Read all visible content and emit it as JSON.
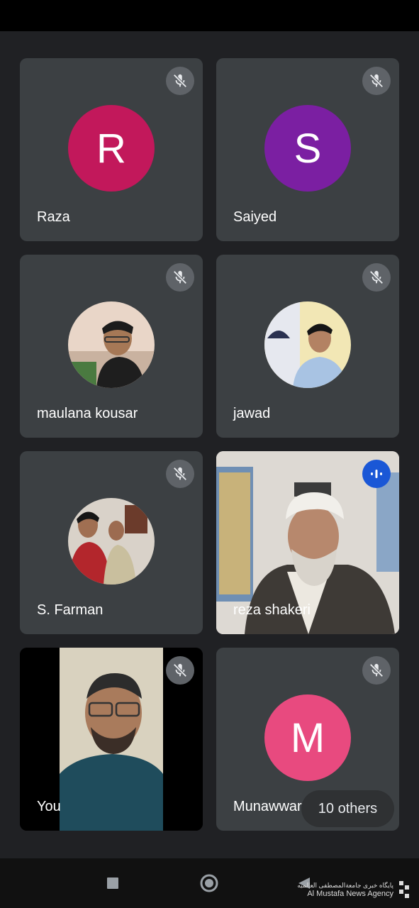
{
  "participants": [
    {
      "name": "Raza",
      "initial": "R",
      "color": "#c2185b",
      "muted": true
    },
    {
      "name": "Saiyed",
      "initial": "S",
      "color": "#7b1fa2",
      "muted": true
    },
    {
      "name": "maulana kousar",
      "muted": true
    },
    {
      "name": "jawad",
      "muted": true
    },
    {
      "name": "S. Farman",
      "muted": true
    },
    {
      "name": "reza shakeri",
      "muted": false,
      "speaking": true
    },
    {
      "name": "You",
      "muted": true
    },
    {
      "name": "Munawwar",
      "initial": "M",
      "color": "#e84a7f",
      "muted": true
    }
  ],
  "others": {
    "label": "10 others"
  },
  "watermark": {
    "line1": "پایگاه خبری جامعة‌المصطفی العالمیه",
    "line2": "Al Mustafa News Agency"
  },
  "icons": {
    "mute": "mic-off-icon",
    "speaking": "audio-level-icon",
    "nav_recent": "square-icon",
    "nav_home": "circle-icon",
    "nav_back": "triangle-back-icon"
  }
}
